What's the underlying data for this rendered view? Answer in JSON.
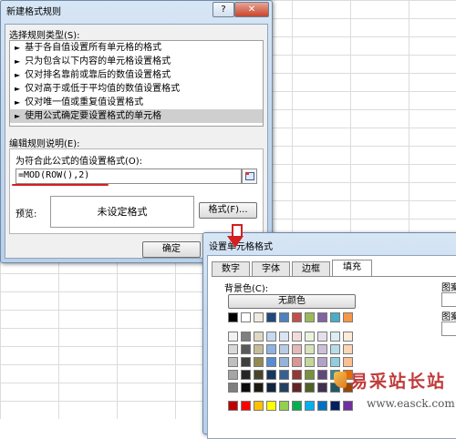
{
  "rule_dialog": {
    "title": "新建格式规则",
    "help_icon": "?",
    "close_icon": "✕",
    "rule_type_label": "选择规则类型(S):",
    "rule_types": [
      "基于各自值设置所有单元格的格式",
      "只为包含以下内容的单元格设置格式",
      "仅对排名靠前或靠后的数值设置格式",
      "仅对高于或低于平均值的数值设置格式",
      "仅对唯一值或重复值设置格式",
      "使用公式确定要设置格式的单元格"
    ],
    "selected_rule_index": 5,
    "edit_label": "编辑规则说明(E):",
    "formula_label": "为符合此公式的值设置格式(O):",
    "formula_value": "=MOD(ROW(),2)",
    "preview_label": "预览:",
    "preview_text": "未设定格式",
    "format_button": "格式(F)...",
    "ok_button": "确定"
  },
  "format_cells_dialog": {
    "title": "设置单元格格式",
    "tabs": [
      "数字",
      "字体",
      "边框",
      "填充"
    ],
    "active_tab": "填充",
    "bg_color_label": "背景色(C):",
    "no_color_button": "无颜色",
    "pattern_label_1": "图案",
    "pattern_label_2": "图案"
  },
  "palette": {
    "row1": [
      "#000000",
      "#ffffff",
      "#eeece1",
      "#1f497d",
      "#4f81bd",
      "#c0504d",
      "#9bbb59",
      "#8064a2",
      "#4bacc6",
      "#f79646"
    ],
    "shades": [
      [
        "#f2f2f2",
        "#7f7f7f",
        "#ddd9c3",
        "#c6d9f0",
        "#dbe5f1",
        "#f2dcdb",
        "#ebf1dd",
        "#e5e0ec",
        "#dbeef3",
        "#fdeada"
      ],
      [
        "#d8d8d8",
        "#595959",
        "#c4bd97",
        "#8db3e2",
        "#b8cce4",
        "#e5b9b7",
        "#d7e3bc",
        "#ccc1d9",
        "#b7dde8",
        "#fbd5b5"
      ],
      [
        "#bfbfbf",
        "#3f3f3f",
        "#938953",
        "#548dd4",
        "#95b3d7",
        "#d99694",
        "#c3d69b",
        "#b2a2c7",
        "#92cddc",
        "#fac08f"
      ],
      [
        "#a5a5a5",
        "#262626",
        "#494429",
        "#17365d",
        "#366092",
        "#953734",
        "#76923c",
        "#5f497a",
        "#31859b",
        "#e36c09"
      ],
      [
        "#7f7f7f",
        "#0c0c0c",
        "#1d1b10",
        "#0f243e",
        "#244061",
        "#632423",
        "#4f6128",
        "#3f3151",
        "#205867",
        "#974806"
      ]
    ],
    "standard": [
      "#c00000",
      "#ff0000",
      "#ffc000",
      "#ffff00",
      "#92d050",
      "#00b050",
      "#00b0f0",
      "#0070c0",
      "#002060",
      "#7030a0"
    ]
  },
  "watermark": {
    "brand": "易采站长站",
    "url": "www.easck.com"
  },
  "colors": {
    "annotation_red": "#d42020"
  }
}
